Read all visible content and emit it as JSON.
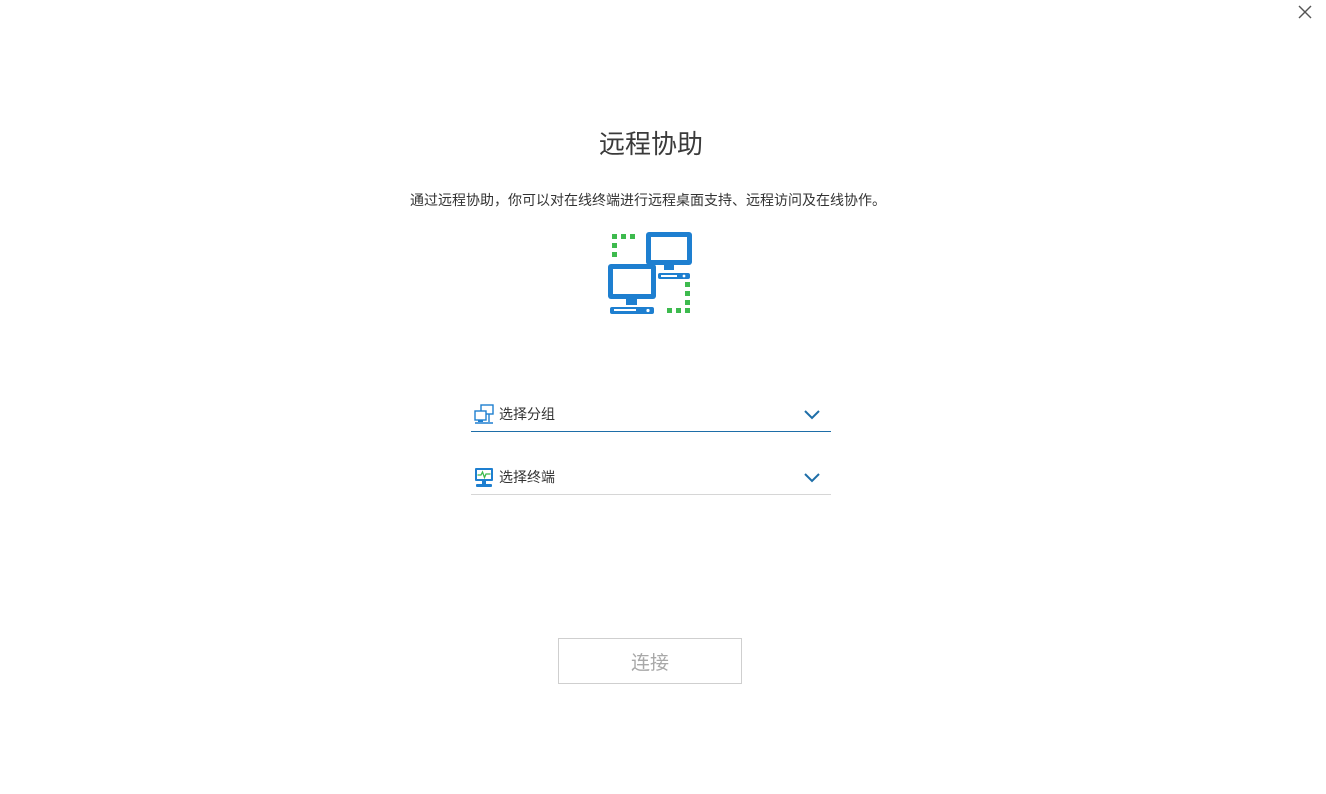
{
  "dialog": {
    "title": "远程协助",
    "description": "通过远程协助，你可以对在线终端进行远程桌面支持、远程访问及在线协作。",
    "hero_icon": "remote-desktop-icon"
  },
  "selects": {
    "group": {
      "icon": "group-network-icon",
      "label": "选择分组"
    },
    "terminal": {
      "icon": "terminal-monitor-icon",
      "label": "选择终端"
    }
  },
  "actions": {
    "connect_label": "连接",
    "close_icon": "close-icon"
  },
  "colors": {
    "primary_blue": "#1e7fd0",
    "dashed_green": "#3dba4e",
    "underline_active": "#1e6ea8",
    "underline_inactive": "#d6d6d6",
    "disabled_text": "#a8a8a8"
  }
}
